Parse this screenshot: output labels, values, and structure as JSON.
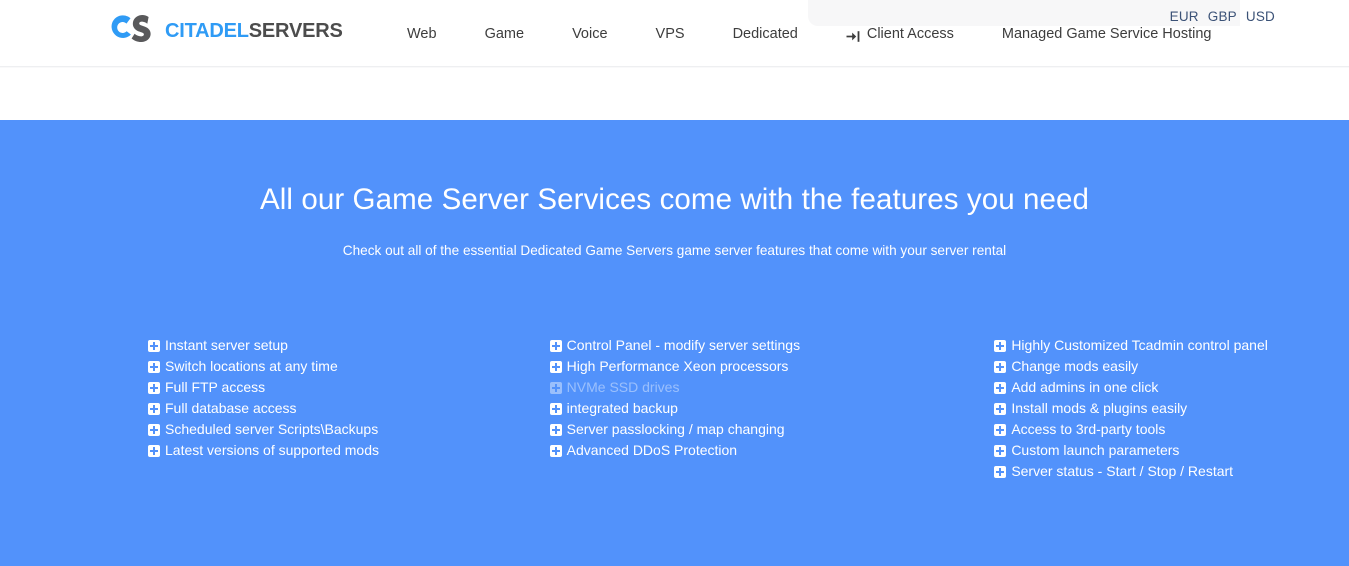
{
  "brand": {
    "mark_icon": "cs-monogram-logo",
    "word_primary": "CITADEL",
    "word_secondary": "SERVERS",
    "primary_color": "#2f9bf5",
    "secondary_color": "#4c4c4c"
  },
  "nav": {
    "items": [
      {
        "label": "Web",
        "icon": null
      },
      {
        "label": "Game",
        "icon": null
      },
      {
        "label": "Voice",
        "icon": null
      },
      {
        "label": "VPS",
        "icon": null
      },
      {
        "label": "Dedicated",
        "icon": null
      },
      {
        "label": "Client Access",
        "icon": "sign-in-icon"
      },
      {
        "label": "Managed Game Service Hosting",
        "icon": null
      }
    ]
  },
  "currency": {
    "options": [
      "EUR",
      "GBP",
      "USD"
    ],
    "text_color": "#3b5277"
  },
  "hero": {
    "title": "All our Game Server Services come with the features you need",
    "subtitle": "Check out all of the essential Dedicated Game Servers game server features that come with your server rental",
    "background_color": "#5292fb",
    "text_color": "#ffffff"
  },
  "features": {
    "bullet_icon": "plus-square-icon",
    "columns": [
      {
        "items": [
          {
            "label": "Instant server setup",
            "dimmed": false
          },
          {
            "label": "Switch locations at any time",
            "dimmed": false
          },
          {
            "label": "Full FTP access",
            "dimmed": false
          },
          {
            "label": "Full database access",
            "dimmed": false
          },
          {
            "label": "Scheduled server Scripts\\Backups",
            "dimmed": false
          },
          {
            "label": "Latest versions of supported mods",
            "dimmed": false
          }
        ]
      },
      {
        "items": [
          {
            "label": "Control Panel - modify server settings",
            "dimmed": false
          },
          {
            "label": "High Performance Xeon processors",
            "dimmed": false
          },
          {
            "label": "NVMe SSD drives",
            "dimmed": true
          },
          {
            "label": "integrated backup",
            "dimmed": false
          },
          {
            "label": "Server passlocking / map changing",
            "dimmed": false
          },
          {
            "label": "Advanced DDoS Protection",
            "dimmed": false
          }
        ]
      },
      {
        "items": [
          {
            "label": "Highly Customized Tcadmin control panel",
            "dimmed": false
          },
          {
            "label": "Change mods easily",
            "dimmed": false
          },
          {
            "label": "Add admins in one click",
            "dimmed": false
          },
          {
            "label": "Install mods & plugins easily",
            "dimmed": false
          },
          {
            "label": "Access to 3rd-party tools",
            "dimmed": false
          },
          {
            "label": "Custom launch parameters",
            "dimmed": false
          },
          {
            "label": "Server status - Start / Stop / Restart",
            "dimmed": false
          }
        ]
      }
    ]
  }
}
